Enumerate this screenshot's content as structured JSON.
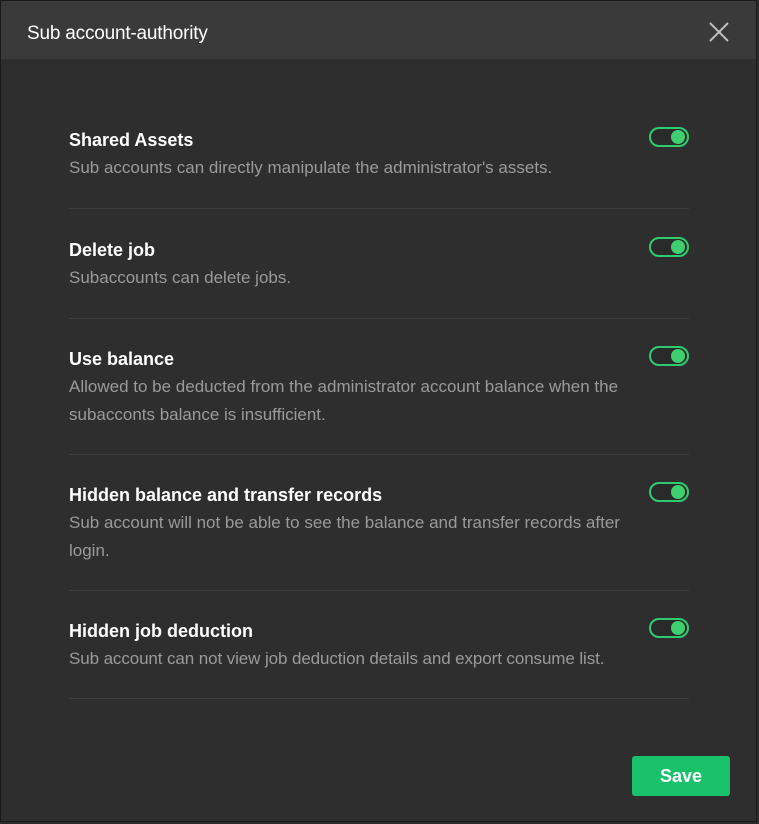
{
  "dialog": {
    "title": "Sub account-authority",
    "close_icon": "close-icon"
  },
  "settings": [
    {
      "title": "Shared Assets",
      "description": "Sub accounts can directly manipulate the administrator's assets.",
      "enabled": true
    },
    {
      "title": "Delete job",
      "description": "Subaccounts can delete jobs.",
      "enabled": true
    },
    {
      "title": "Use balance",
      "description": "Allowed to be deducted from the administrator account balance when the subacconts balance is insufficient.",
      "enabled": true
    },
    {
      "title": "Hidden balance and transfer records",
      "description": "Sub account will not be able to see the balance and transfer records after login.",
      "enabled": true
    },
    {
      "title": "Hidden job deduction",
      "description": "Sub account can not view job deduction details and export consume list.",
      "enabled": true
    }
  ],
  "footer": {
    "save_label": "Save"
  },
  "colors": {
    "accent": "#19c16b",
    "toggle_on": "#3ecf6f",
    "background": "#2e2e2e",
    "header": "#3a3a3a",
    "description_text": "#9a9a9a"
  }
}
